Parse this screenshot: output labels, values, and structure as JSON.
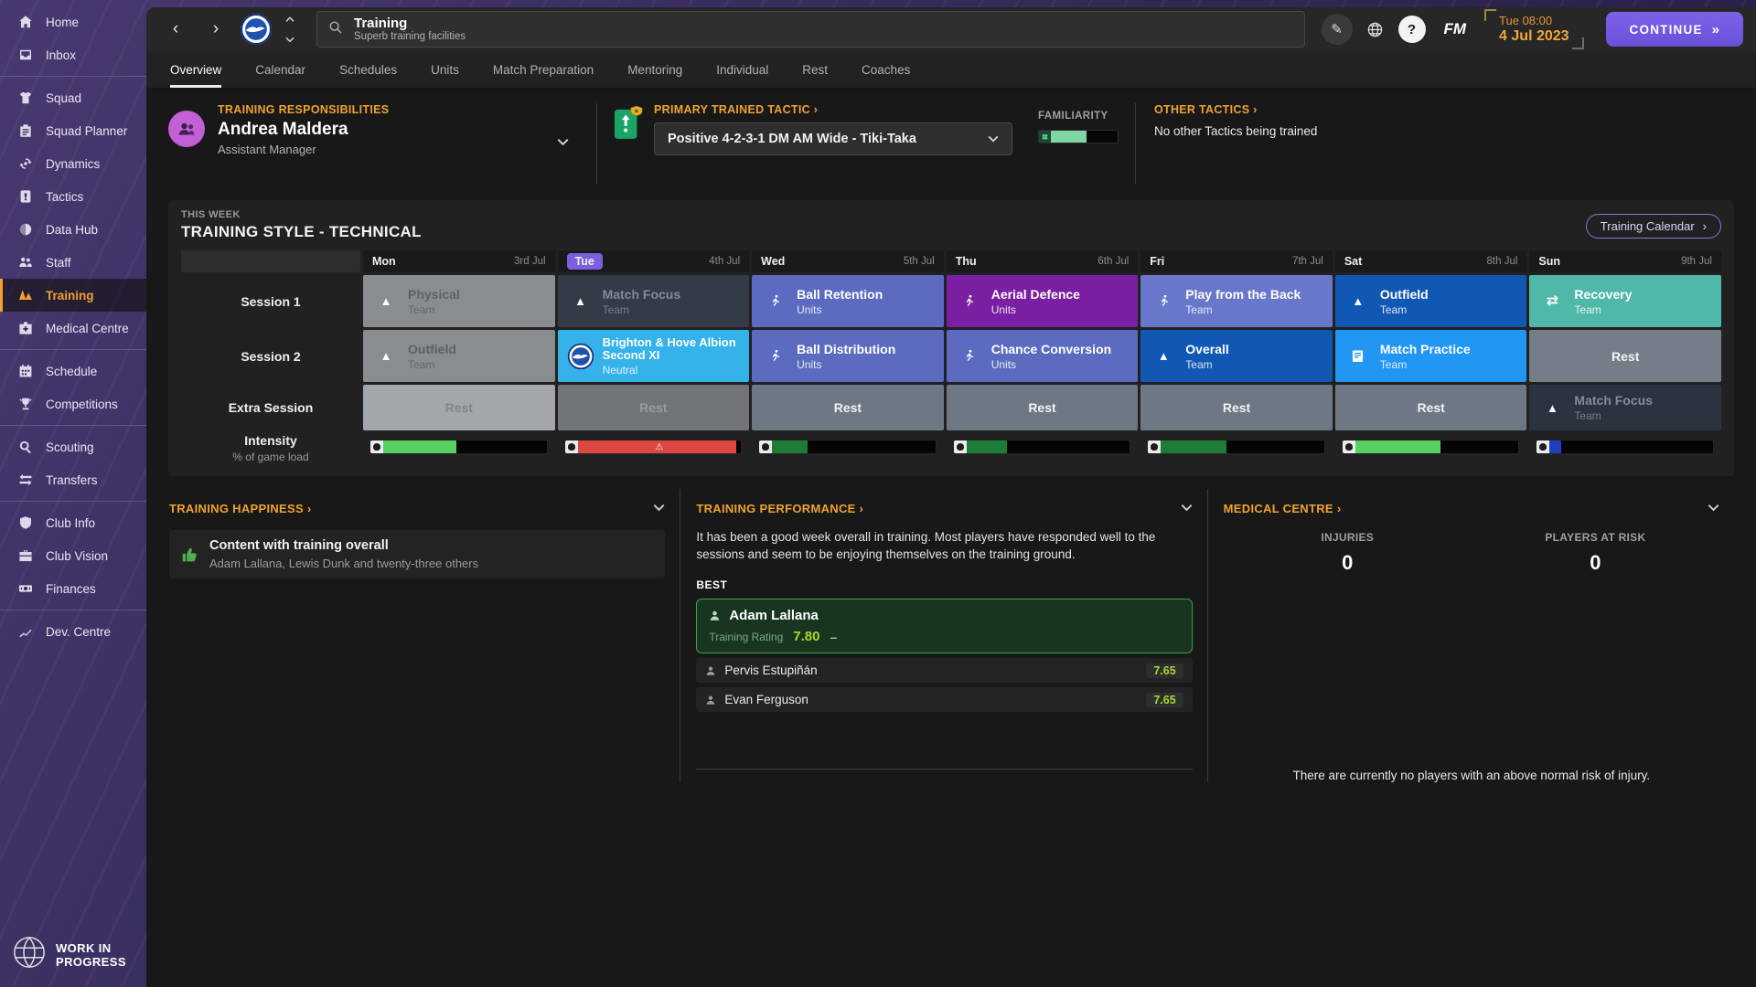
{
  "palette": {
    "accent": "#f0a22e",
    "tab_purple": "#7a5fe0",
    "rating_green": "#a9d82b",
    "familiarity_green": "#7fd8a4",
    "happy_green": "#4caf50",
    "bar_green_bright": "#55d061",
    "bar_green_dark": "#1d7c35",
    "bar_red": "#dd4742",
    "bar_blue": "#1f3fc0",
    "cell_past_gray": "#8a8d90",
    "cell_past_dark": "#343a46",
    "cell_periwinkle": "#5c6bc0",
    "cell_periwinkle_light": "#6877c9",
    "cell_purple": "#7b1fa2",
    "cell_dark_blue": "#1158b4",
    "cell_teal": "#4fb8a8",
    "cell_cyan": "#35b2ea",
    "cell_bright_blue": "#2196f3",
    "cell_rest_past_light": "#a3a7ab",
    "cell_rest_past_mid": "#717579",
    "cell_rest_future": "#6d7884",
    "cell_rest_sun": "#757e88",
    "cell_night": "#2b3340"
  },
  "sidebar": {
    "groups": [
      {
        "items": [
          {
            "label": "Home",
            "icon": "home"
          },
          {
            "label": "Inbox",
            "icon": "inbox"
          }
        ]
      },
      {
        "items": [
          {
            "label": "Squad",
            "icon": "squad"
          },
          {
            "label": "Squad Planner",
            "icon": "planner"
          },
          {
            "label": "Dynamics",
            "icon": "dynamics"
          },
          {
            "label": "Tactics",
            "icon": "tactics"
          },
          {
            "label": "Data Hub",
            "icon": "datahub"
          },
          {
            "label": "Staff",
            "icon": "staff"
          },
          {
            "label": "Training",
            "icon": "training",
            "active": true
          },
          {
            "label": "Medical Centre",
            "icon": "medical"
          }
        ]
      },
      {
        "items": [
          {
            "label": "Schedule",
            "icon": "schedule"
          },
          {
            "label": "Competitions",
            "icon": "competitions"
          }
        ]
      },
      {
        "items": [
          {
            "label": "Scouting",
            "icon": "scouting"
          },
          {
            "label": "Transfers",
            "icon": "transfers"
          }
        ]
      },
      {
        "items": [
          {
            "label": "Club Info",
            "icon": "clubinfo"
          },
          {
            "label": "Club Vision",
            "icon": "vision"
          },
          {
            "label": "Finances",
            "icon": "finances"
          }
        ]
      },
      {
        "items": [
          {
            "label": "Dev. Centre",
            "icon": "devcentre"
          }
        ]
      }
    ],
    "footer": {
      "line1": "WORK IN",
      "line2": "PROGRESS"
    }
  },
  "topbar": {
    "title": "Training",
    "subtitle": "Superb training facilities",
    "fm_logo": "FM",
    "clock_time": "Tue 08:00",
    "clock_date": "4 Jul 2023",
    "continue_label": "CONTINUE"
  },
  "tabs": {
    "active_index": 0,
    "items": [
      "Overview",
      "Calendar",
      "Schedules",
      "Units",
      "Match Preparation",
      "Mentoring",
      "Individual",
      "Rest",
      "Coaches"
    ]
  },
  "resp": {
    "label": "TRAINING RESPONSIBILITIES",
    "name": "Andrea Maldera",
    "role": "Assistant Manager"
  },
  "tactic": {
    "label": "PRIMARY TRAINED TACTIC",
    "value": "Positive 4-2-3-1 DM AM Wide - Tiki-Taka",
    "familiarity_label": "FAMILIARITY",
    "familiarity_pct": 45
  },
  "other": {
    "label": "OTHER TACTICS",
    "text": "No other Tactics being trained"
  },
  "week": {
    "eyebrow": "THIS WEEK",
    "title": "TRAINING STYLE - TECHNICAL",
    "calendar_button": "Training Calendar",
    "row_labels": {
      "session1": "Session 1",
      "session2": "Session 2",
      "extra": "Extra Session",
      "intensity": "Intensity",
      "intensity_sub": "% of game load"
    },
    "days": [
      {
        "name": "Mon",
        "date": "3rd Jul",
        "today": false,
        "s1": {
          "title": "Physical",
          "sub": "Team",
          "bg": "cell_past_gray",
          "fg": "#5d6165",
          "icon": "cone"
        },
        "s2": {
          "title": "Outfield",
          "sub": "Team",
          "bg": "cell_past_gray",
          "fg": "#5d6165",
          "icon": "cone"
        },
        "extra": {
          "title": "Rest",
          "bg": "cell_rest_past_light",
          "fg": "#82868a",
          "rest": true
        },
        "intensity": {
          "pct": 45,
          "color": "bar_green_bright",
          "warn": false
        }
      },
      {
        "name": "Tue",
        "date": "4th Jul",
        "today": true,
        "s1": {
          "title": "Match Focus",
          "sub": "Team",
          "bg": "cell_past_dark",
          "fg": "#818b99",
          "icon": "cone"
        },
        "s2": {
          "title": "Brighton & Hove Albion Second XI",
          "sub": "Neutral",
          "bg": "cell_cyan",
          "fg": "#ffffff",
          "icon": "crest"
        },
        "extra": {
          "title": "Rest",
          "bg": "cell_rest_past_mid",
          "fg": "#989b9f",
          "rest": true
        },
        "intensity": {
          "pct": 97,
          "color": "bar_red",
          "warn": true
        }
      },
      {
        "name": "Wed",
        "date": "5th Jul",
        "today": false,
        "s1": {
          "title": "Ball Retention",
          "sub": "Units",
          "bg": "cell_periwinkle",
          "fg": "#ffffff",
          "icon": "runner"
        },
        "s2": {
          "title": "Ball Distribution",
          "sub": "Units",
          "bg": "cell_periwinkle",
          "fg": "#ffffff",
          "icon": "runner"
        },
        "extra": {
          "title": "Rest",
          "bg": "cell_rest_future",
          "fg": "#f2f2f2",
          "rest": true
        },
        "intensity": {
          "pct": 22,
          "color": "bar_green_dark",
          "warn": false
        }
      },
      {
        "name": "Thu",
        "date": "6th Jul",
        "today": false,
        "s1": {
          "title": "Aerial Defence",
          "sub": "Units",
          "bg": "cell_purple",
          "fg": "#ffffff",
          "icon": "runner"
        },
        "s2": {
          "title": "Chance Conversion",
          "sub": "Units",
          "bg": "cell_periwinkle",
          "fg": "#ffffff",
          "icon": "runner"
        },
        "extra": {
          "title": "Rest",
          "bg": "cell_rest_future",
          "fg": "#f2f2f2",
          "rest": true
        },
        "intensity": {
          "pct": 25,
          "color": "bar_green_dark",
          "warn": false
        }
      },
      {
        "name": "Fri",
        "date": "7th Jul",
        "today": false,
        "s1": {
          "title": "Play from the Back",
          "sub": "Team",
          "bg": "cell_periwinkle_light",
          "fg": "#ffffff",
          "icon": "runner"
        },
        "s2": {
          "title": "Overall",
          "sub": "Team",
          "bg": "cell_dark_blue",
          "fg": "#ffffff",
          "icon": "cone"
        },
        "extra": {
          "title": "Rest",
          "bg": "cell_rest_future",
          "fg": "#f2f2f2",
          "rest": true
        },
        "intensity": {
          "pct": 40,
          "color": "bar_green_dark",
          "warn": false
        }
      },
      {
        "name": "Sat",
        "date": "8th Jul",
        "today": false,
        "s1": {
          "title": "Outfield",
          "sub": "Team",
          "bg": "cell_dark_blue",
          "fg": "#ffffff",
          "icon": "cone"
        },
        "s2": {
          "title": "Match Practice",
          "sub": "Team",
          "bg": "cell_bright_blue",
          "fg": "#ffffff",
          "icon": "clipboard"
        },
        "extra": {
          "title": "Rest",
          "bg": "cell_rest_future",
          "fg": "#f2f2f2",
          "rest": true
        },
        "intensity": {
          "pct": 52,
          "color": "bar_green_bright",
          "warn": false
        }
      },
      {
        "name": "Sun",
        "date": "9th Jul",
        "today": false,
        "s1": {
          "title": "Recovery",
          "sub": "Team",
          "bg": "cell_teal",
          "fg": "#ffffff",
          "icon": "arrows"
        },
        "s2": {
          "title": "Rest",
          "bg": "cell_rest_sun",
          "fg": "#f2f2f2",
          "rest": true
        },
        "extra": {
          "title": "Match Focus",
          "sub": "Team",
          "bg": "cell_night",
          "fg": "#828b98",
          "icon": "cone"
        },
        "intensity": {
          "pct": 7,
          "color": "bar_blue",
          "warn": false
        }
      }
    ]
  },
  "happiness": {
    "label": "TRAINING HAPPINESS",
    "item": {
      "title": "Content with training overall",
      "subtitle": "Adam Lallana, Lewis Dunk and twenty-three others"
    }
  },
  "performance": {
    "label": "TRAINING PERFORMANCE",
    "summary": "It has been a good week overall in training. Most players have responded well to the sessions and seem to be enjoying themselves on the training ground.",
    "best_label": "BEST",
    "best": {
      "name": "Adam Lallana",
      "rating_label": "Training Rating",
      "rating": "7.80",
      "trend": "–"
    },
    "others": [
      {
        "name": "Pervis Estupiñán",
        "rating": "7.65"
      },
      {
        "name": "Evan Ferguson",
        "rating": "7.65"
      }
    ]
  },
  "medical": {
    "label": "MEDICAL CENTRE",
    "injuries_label": "INJURIES",
    "injuries": "0",
    "risk_label": "PLAYERS AT RISK",
    "players_at_risk": "0",
    "note": "There are currently no players with an above normal risk of injury."
  }
}
